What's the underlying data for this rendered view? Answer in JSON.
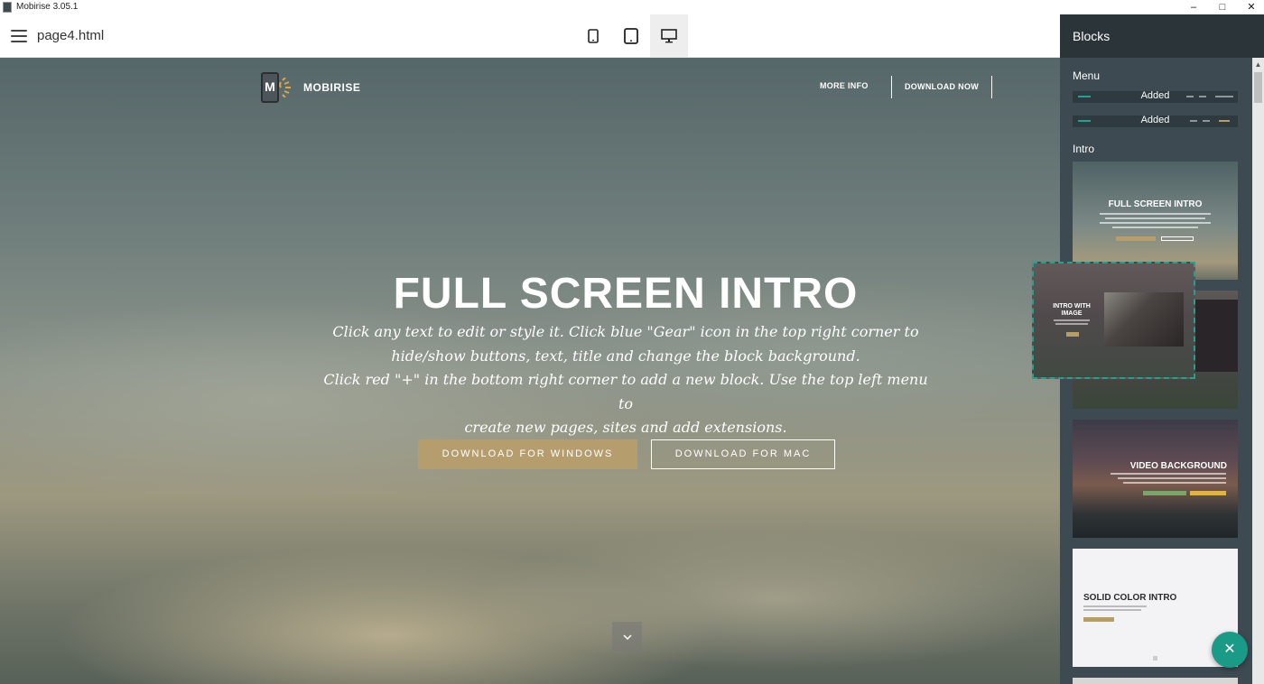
{
  "window": {
    "title": "Mobirise 3.05.1",
    "controls": [
      "–",
      "□",
      "✕"
    ]
  },
  "toolbar": {
    "page_name": "page4.html",
    "devices": [
      "mobile-icon",
      "tablet-icon",
      "desktop-icon"
    ],
    "active_device": "desktop"
  },
  "site": {
    "brand": "MOBIRISE",
    "logo_letter": "M",
    "nav": {
      "more_info": "MORE INFO",
      "download_now": "DOWNLOAD NOW"
    },
    "hero": {
      "title": "FULL SCREEN INTRO",
      "text_line1": "Click any text to edit or style it. Click blue \"Gear\" icon in the top right corner to",
      "text_line2": "hide/show buttons, text, title and change the block background.",
      "text_line3": "Click red \"+\" in the bottom right corner to add a new block. Use the top left menu to",
      "text_line4": "create new pages, sites and add extensions.",
      "btn_windows": "DOWNLOAD FOR WINDOWS",
      "btn_mac": "DOWNLOAD FOR MAC"
    }
  },
  "blocks_panel": {
    "title": "Blocks",
    "menu_label": "Menu",
    "menu_items": [
      {
        "status": "Added"
      },
      {
        "status": "Added"
      }
    ],
    "intro_label": "Intro",
    "thumbnails": {
      "full_screen": "FULL SCREEN INTRO",
      "video": "VIDEO BACKGROUND",
      "solid": "SOLID COLOR INTRO"
    },
    "dragged": "INTRO WITH IMAGE"
  },
  "colors": {
    "accent": "#b69d6e",
    "panel": "#3d4a52",
    "fab": "#1b9a88",
    "drag_border": "#2a9d8f"
  }
}
